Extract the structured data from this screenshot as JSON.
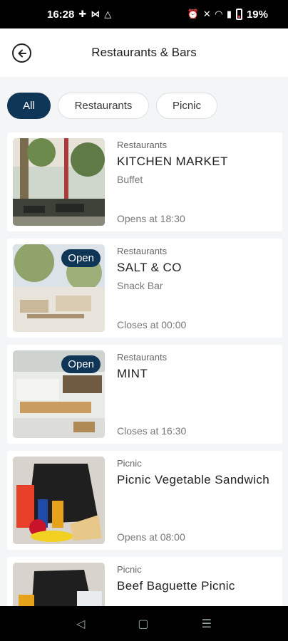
{
  "status_bar": {
    "time": "16:28",
    "battery": "19%",
    "icons": [
      "hash-icon",
      "link-icon",
      "drive-icon",
      "alarm-icon",
      "mute-icon",
      "wifi-icon",
      "signal-icon",
      "battery-icon"
    ]
  },
  "header": {
    "title": "Restaurants & Bars",
    "back_icon": "back-arrow-icon"
  },
  "filters": {
    "items": [
      {
        "label": "All",
        "active": true
      },
      {
        "label": "Restaurants",
        "active": false
      },
      {
        "label": "Picnic",
        "active": false
      }
    ]
  },
  "venues": [
    {
      "category": "Restaurants",
      "name": "KITCHEN MARKET",
      "subtitle": "Buffet",
      "hours": "Opens at 18:30",
      "badge": ""
    },
    {
      "category": "Restaurants",
      "name": "SALT & CO",
      "subtitle": "Snack Bar",
      "hours": "Closes at 00:00",
      "badge": "Open"
    },
    {
      "category": "Restaurants",
      "name": "MINT",
      "subtitle": "",
      "hours": "Closes at 16:30",
      "badge": "Open"
    },
    {
      "category": "Picnic",
      "name": "Picnic Vegetable Sandwich",
      "subtitle": "",
      "hours": "Opens at 08:00",
      "badge": ""
    },
    {
      "category": "Picnic",
      "name": "Beef Baguette Picnic",
      "subtitle": "",
      "hours": "",
      "badge": ""
    }
  ],
  "nav_bar": {
    "icons": [
      "back-nav-icon",
      "home-nav-icon",
      "recents-nav-icon"
    ]
  }
}
